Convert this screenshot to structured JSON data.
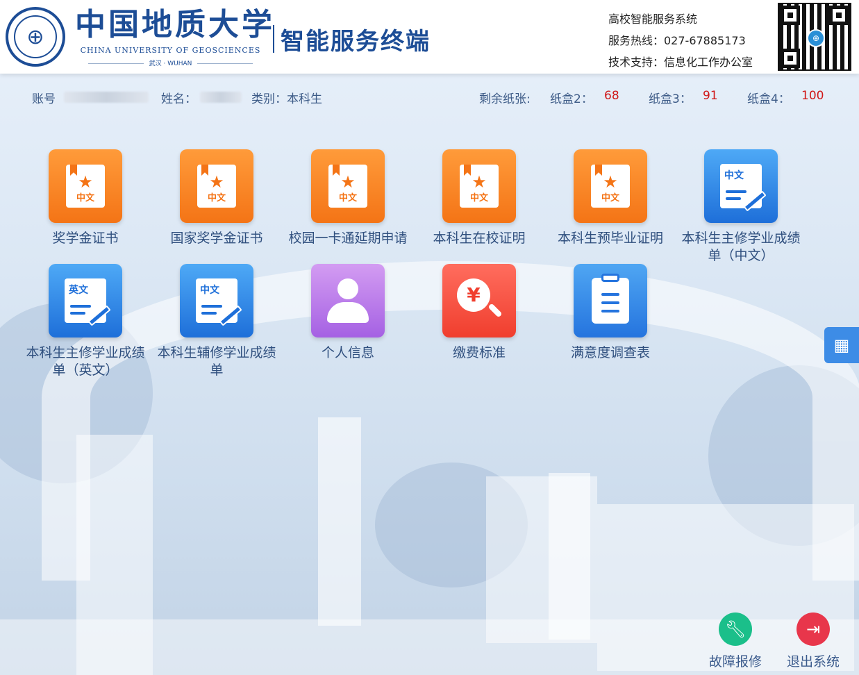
{
  "header": {
    "university_cn": "中国地质大学",
    "university_en": "CHINA UNIVERSITY OF GEOSCIENCES",
    "location": "武汉 · WUHAN",
    "terminal_title": "智能服务终端",
    "system_name": "高校智能服务系统",
    "hotline": "服务热线：027-67885173",
    "support": "技术支持：信息化工作办公室"
  },
  "status": {
    "account_label": "账号",
    "name_label": "姓名：",
    "category": "类别：本科生",
    "paper_label": "剩余纸张:",
    "tray2_label": "纸盒2：",
    "tray2_count": "68",
    "tray3_label": "纸盒3：",
    "tray3_count": "91",
    "tray4_label": "纸盒4：",
    "tray4_count": "100"
  },
  "tiles": [
    {
      "label": "奖学金证书",
      "icon": "certificate-star-icon",
      "badge": "中文"
    },
    {
      "label": "国家奖学金证书",
      "icon": "certificate-star-icon",
      "badge": "中文"
    },
    {
      "label": "校园一卡通延期申请",
      "icon": "certificate-star-icon",
      "badge": "中文"
    },
    {
      "label": "本科生在校证明",
      "icon": "certificate-star-icon",
      "badge": "中文"
    },
    {
      "label": "本科生预毕业证明",
      "icon": "certificate-star-icon",
      "badge": "中文"
    },
    {
      "label": "本科生主修学业成绩单（中文）",
      "icon": "transcript-icon",
      "badge": "中文"
    },
    {
      "label": "本科生主修学业成绩单（英文）",
      "icon": "transcript-icon",
      "badge": "英文"
    },
    {
      "label": "本科生辅修学业成绩单",
      "icon": "transcript-icon",
      "badge": "中文"
    },
    {
      "label": "个人信息",
      "icon": "person-icon"
    },
    {
      "label": "缴费标准",
      "icon": "fee-search-icon",
      "badge": "¥"
    },
    {
      "label": "满意度调查表",
      "icon": "clipboard-icon"
    }
  ],
  "bottom": {
    "repair": "故障报修",
    "exit": "退出系统"
  },
  "colors": {
    "primary_blue": "#1d4d96",
    "orange": "#f47416",
    "count_red": "#d01818"
  }
}
